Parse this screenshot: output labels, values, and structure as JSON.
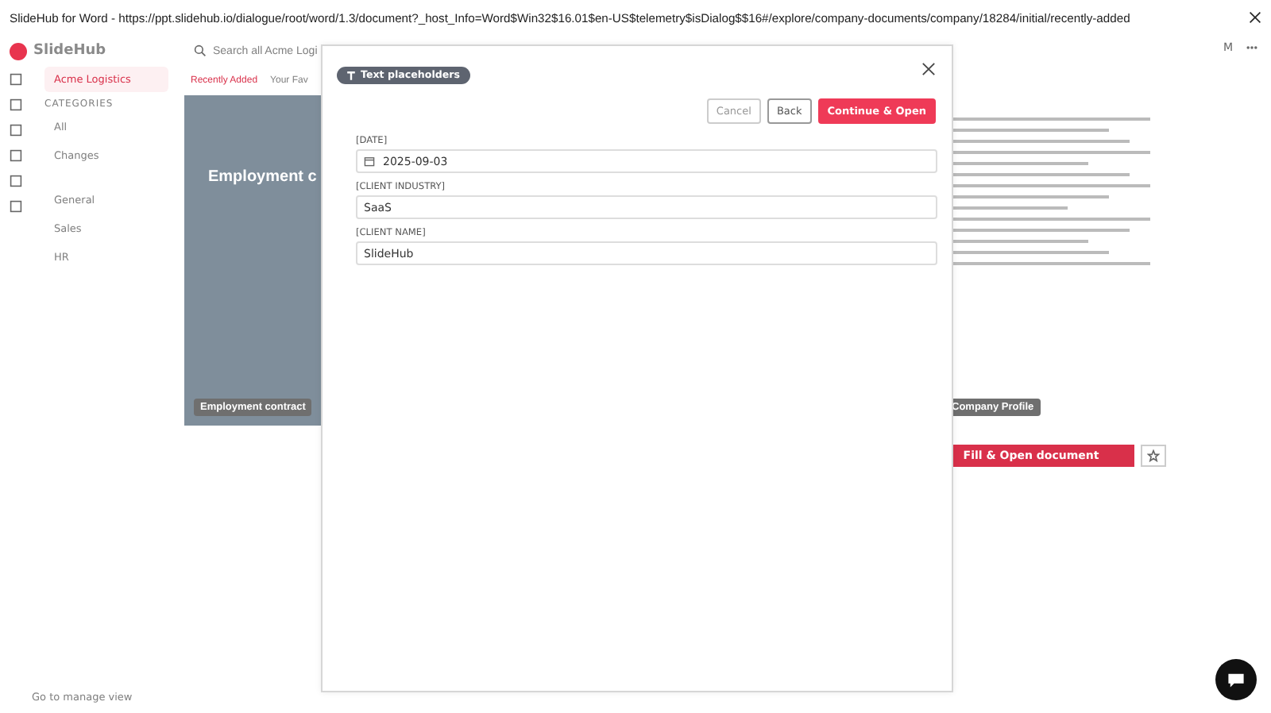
{
  "window": {
    "title": "SlideHub for Word - https://ppt.slidehub.io/dialogue/root/word/1.3/document?_host_Info=Word$Win32$16.01$en-US$telemetry$isDialog$$16#/explore/company-documents/company/18284/initial/recently-added"
  },
  "app": {
    "logo": "SlideHub",
    "avatar": "M",
    "workspace": "Acme Logistics",
    "categories_heading": "CATEGORIES",
    "categories": [
      {
        "label": "All"
      },
      {
        "label": "Changes"
      }
    ],
    "tags": [
      {
        "label": "General"
      },
      {
        "label": "Sales"
      },
      {
        "label": "HR"
      }
    ],
    "manage_link": "Go to manage view",
    "search": {
      "placeholder": "Search all Acme Logi"
    },
    "tabs": [
      {
        "label": "Recently Added",
        "selected": true
      },
      {
        "label": "Your Fav",
        "selected": false
      }
    ],
    "cards": [
      {
        "title": "Employment c",
        "label": "Employment contract"
      },
      {
        "label": "Company Profile",
        "action": "Fill & Open document"
      }
    ]
  },
  "dialog": {
    "chip": "Text placeholders",
    "buttons": [
      {
        "label": "Cancel",
        "kind": "secondary",
        "disabled": true
      },
      {
        "label": "Back",
        "kind": "secondary",
        "disabled": false
      },
      {
        "label": "Continue & Open",
        "kind": "primary",
        "disabled": false
      }
    ],
    "fields": [
      {
        "label": "[DATE]",
        "value": "2025-09-03",
        "kind": "date"
      },
      {
        "label": "[CLIENT INDUSTRY]",
        "value": "SaaS",
        "kind": "text"
      },
      {
        "label": "[CLIENT NAME]",
        "value": "SlideHub",
        "kind": "text"
      }
    ]
  }
}
